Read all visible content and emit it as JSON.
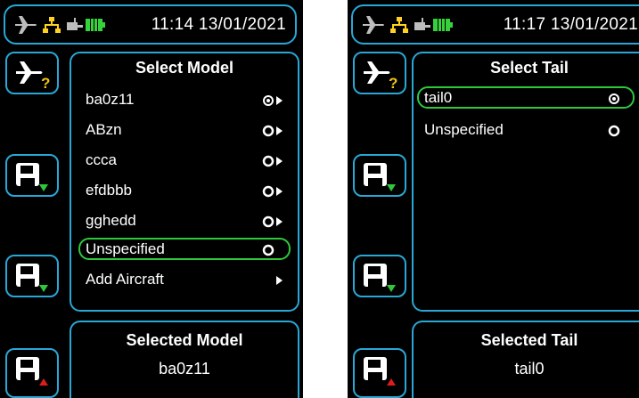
{
  "left": {
    "status": {
      "time": "11:14 13/01/2021"
    },
    "list_panel": {
      "title": "Select Model",
      "items": [
        {
          "label": "ba0z11"
        },
        {
          "label": "ABzn"
        },
        {
          "label": "ccca"
        },
        {
          "label": "efdbbb"
        },
        {
          "label": "gghedd"
        },
        {
          "label": "Unspecified"
        },
        {
          "label": "Add Aircraft"
        }
      ]
    },
    "selected_panel": {
      "title": "Selected Model",
      "value": "ba0z11"
    }
  },
  "right": {
    "status": {
      "time": "11:17 13/01/2021"
    },
    "list_panel": {
      "title": "Select Tail",
      "items": [
        {
          "label": "tail0"
        },
        {
          "label": "Unspecified"
        }
      ]
    },
    "selected_panel": {
      "title": "Selected Tail",
      "value": "tail0"
    }
  },
  "colors": {
    "frame": "#29a7d6",
    "highlight": "#2ec93a",
    "battery": "#36d23c",
    "network": "#ffd21f",
    "warn": "#e01b1b"
  },
  "icons": [
    "airplane-icon",
    "network-icon",
    "cable-icon",
    "battery-icon",
    "airplane-question-icon",
    "save-down-icon",
    "save-up-icon",
    "radio-selected-icon",
    "radio-empty-icon",
    "submenu-arrow-icon"
  ]
}
